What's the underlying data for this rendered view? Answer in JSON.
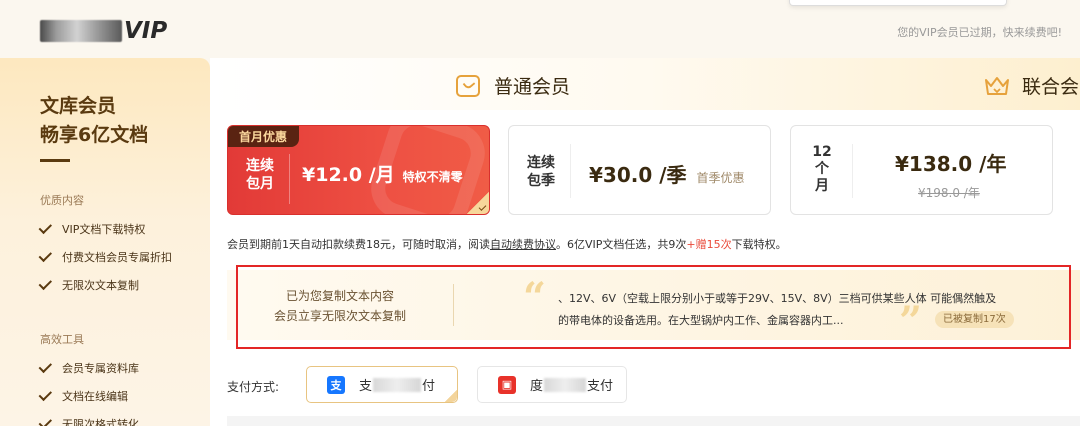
{
  "header": {
    "logo_suffix": "VIP",
    "expired_note": "您的VIP会员已过期，快来续费吧!"
  },
  "sidebar": {
    "title_line1": "文库会员",
    "title_line2": "畅享6亿文档",
    "sections": [
      {
        "label": "优质内容",
        "items": [
          "VIP文档下载特权",
          "付费文档会员专属折扣",
          "无限次文本复制"
        ]
      },
      {
        "label": "高效工具",
        "items": [
          "会员专属资料库",
          "文档在线编辑",
          "无限次格式转化"
        ]
      }
    ]
  },
  "tabs": {
    "normal": "普通会员",
    "union": "联合会"
  },
  "plans": [
    {
      "badge": "首月优惠",
      "name": "连续包月",
      "price": "¥12.0 /月",
      "note": "特权不清零"
    },
    {
      "name": "连续包季",
      "price": "¥30.0 /季",
      "note": "首季优惠"
    },
    {
      "name": "12个月",
      "price": "¥138.0 /年",
      "original": "¥198.0 /年"
    }
  ],
  "renew_note": {
    "text_before": "会员到期前1天自动扣款续费18元，可随时取消，阅读",
    "link": "自动续费协议",
    "text_mid": "。6亿VIP文档任选，共9次",
    "bonus": "+赠15次",
    "text_end": "下载特权。"
  },
  "copy_banner": {
    "line1": "已为您复制文本内容",
    "line2": "会员立享无限次文本复制",
    "text_line1": "、12V、6V（空载上限分别小于或等于29V、15V、8V）三档可供某些人体 可能偶然触及",
    "text_line2": "的带电体的设备选用。在大型锅炉内工作、金属容器内工...",
    "count": "已被复制17次"
  },
  "payment": {
    "label": "支付方式:",
    "methods": [
      {
        "icon_name": "alipay-icon",
        "prefix": "支",
        "suffix": "付"
      },
      {
        "icon_name": "baidu-pay-icon",
        "prefix": "度",
        "suffix": "支付"
      }
    ]
  },
  "colors": {
    "accent_red": "#e23a37",
    "gold": "#e6a23c",
    "highlight_box": "#e32626"
  }
}
